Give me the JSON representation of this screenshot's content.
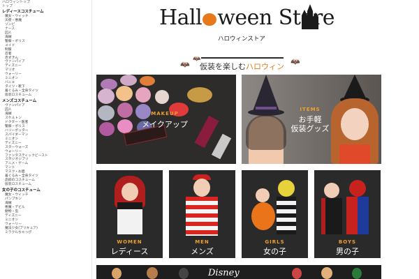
{
  "sidebar": {
    "breadcrumb": [
      "ハロウィントップ",
      "トップ"
    ],
    "sections": [
      {
        "heading": "レディースコスチューム",
        "items": [
          "魔女・ウィッチ",
          "天使・悪魔",
          "ゾンビ",
          "ナース",
          "囚人",
          "海賊",
          "警察・ポリス",
          "メイド",
          "制服",
          "忍者",
          "赤ずきん",
          "ヴァンパイア",
          "ディズニー",
          "マリオ",
          "ウォーリー",
          "ミニオン",
          "バニエ",
          "タイツ・靴下",
          "着ぐるみ・全身タイツ",
          "仮装ロスチューム"
        ]
      },
      {
        "heading": "メンズコスチューム",
        "items": [
          "ヴァンパイア",
          "囚人",
          "海賊",
          "スケルトン",
          "ドクター・医者",
          "警察・ポリス",
          "ハリーポッター",
          "スパイダーマン",
          "ミニオン",
          "ディズニー",
          "スターウォーズ",
          "ウォーリー",
          "ファンタスティックビースト",
          "スタジオジブリ",
          "アニメ・ゲーム",
          "マント",
          "マスク・お面",
          "着ぐるみ・全身タイツ",
          "品揃のコスチューム",
          "仮装ロスチューム"
        ]
      },
      {
        "heading": "女の子のコスチューム",
        "items": [
          "魔女・ウィッチ",
          "パンプキン",
          "海賊",
          "悪魔・デビル",
          "動物・虫",
          "ディズニー",
          "ミニオン",
          "ウォーリー",
          "魔法少女(プリキュア)",
          "ミラクルちゃっぴ"
        ]
      }
    ]
  },
  "logo": {
    "title_before": "Hall",
    "title_after": "ween Store",
    "subtitle": "ハロウィンストア"
  },
  "tagline": {
    "prefix": "仮装を楽しむ",
    "highlight": "ハロウィン"
  },
  "banners": {
    "makeup": {
      "en": "MAKEUP",
      "jp": "メイクアップ"
    },
    "items": {
      "en": "ITEMS",
      "jp_line1": "お手軽",
      "jp_line2": "仮装グッズ"
    }
  },
  "categories": [
    {
      "en": "WOMEN",
      "jp": "レディース"
    },
    {
      "en": "MEN",
      "jp": "メンズ"
    },
    {
      "en": "GIRLS",
      "jp": "女の子"
    },
    {
      "en": "BOYS",
      "jp": "男の子"
    }
  ],
  "disney": {
    "label": "Disney"
  },
  "colors": {
    "accent": "#e07a16",
    "banner_dark": "#2e2c2b",
    "label_orange": "#f0a030"
  }
}
